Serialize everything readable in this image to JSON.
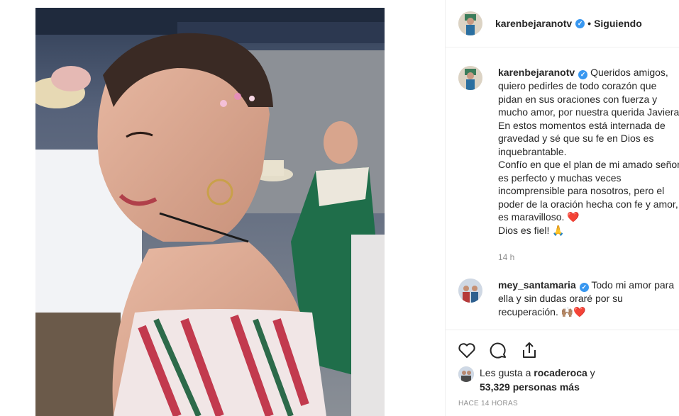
{
  "post": {
    "image_alt": "Foto de una mujer con el cabello corto sonriendo, aretes de aro y vestido estampado"
  },
  "header": {
    "username": "karenbejaranotv",
    "separator": "•",
    "follow_status": "Siguiendo"
  },
  "caption": {
    "author": "karenbejaranotv",
    "text": "Queridos amigos, quiero pedirles de todo corazón que pidan en sus oraciones con fuerza y mucho amor, por nuestra querida Javiera. En estos momentos está internada de gravedad y sé que su fe en Dios es inquebrantable.\nConfío en que el plan de mi amado señor es perfecto y muchas veces incomprensible para nosotros, pero el poder de la oración hecha con fe y amor, es maravilloso. ❤️\nDios es fiel! 🙏",
    "time": "14 h"
  },
  "comments": [
    {
      "author": "mey_santamaria",
      "text": "Todo mi amor para ella y sin dudas oraré por su recuperación. 🙌🏽❤️"
    }
  ],
  "likes": {
    "prefix": "Les gusta a",
    "user": "rocaderoca",
    "connector": "y",
    "count_text": "53,329 personas más"
  },
  "posted_ago": "HACE 14 HORAS",
  "icons": [
    "heart-icon",
    "comment-icon",
    "share-icon",
    "verified-badge-icon"
  ],
  "colors": {
    "verified": "#3897f0",
    "muted": "#8e8e8e",
    "text": "#262626",
    "heart": "#ed4956"
  }
}
